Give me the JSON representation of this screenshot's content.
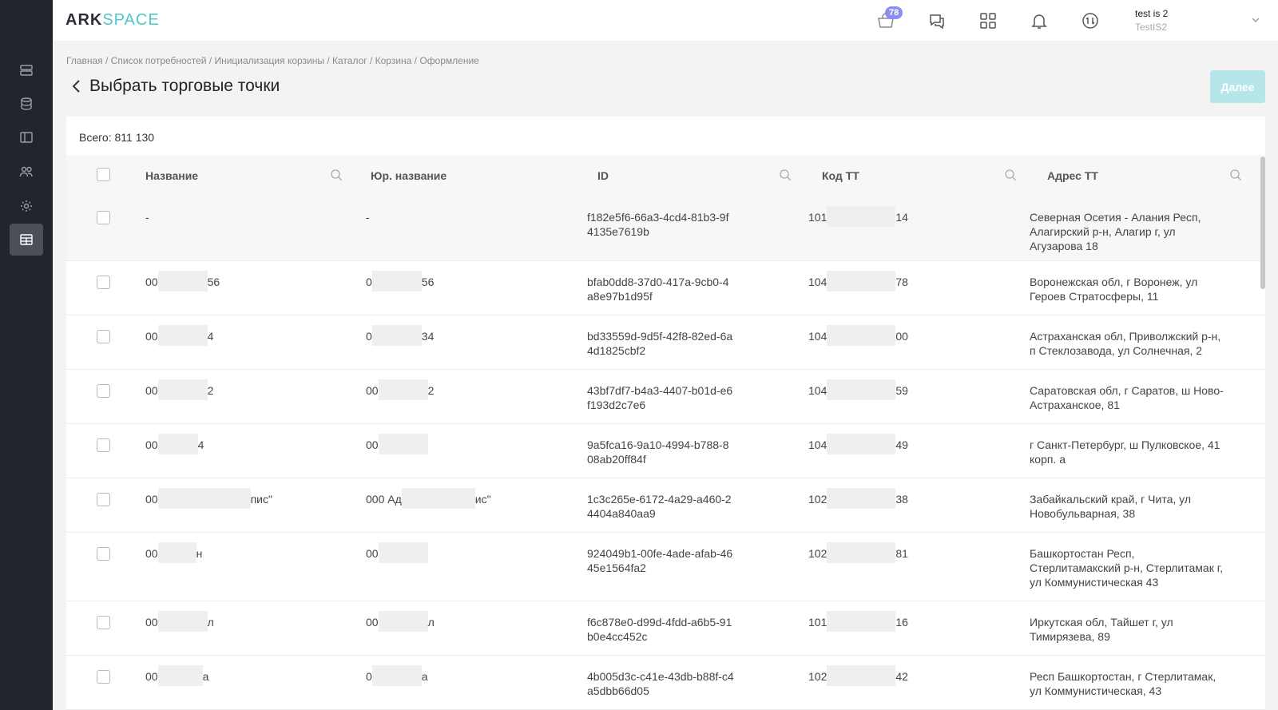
{
  "logo": {
    "ark": "ARK",
    "space": "SPACE"
  },
  "topbar": {
    "cart_badge": "78",
    "user_name": "test is 2",
    "user_org": "TestIS2"
  },
  "breadcrumb": "Главная / Список потребностей / Инициализация корзины / Каталог / Корзина / Оформление",
  "page_title": "Выбрать торговые точки",
  "next_label": "Далее",
  "total": "Всего: 811 130",
  "columns": [
    "Название",
    "Юр. название",
    "ID",
    "Код ТТ",
    "Адрес ТТ"
  ],
  "rows": [
    {
      "name": [
        "-",
        ""
      ],
      "legal": [
        "-",
        ""
      ],
      "id": "f182e5f6-66a3-4cd4-81b3-9f4135e7619b",
      "code": [
        "101",
        "14"
      ],
      "address": "Северная Осетия - Алания Респ, Алагирский р-н, Алагир г, ул Агузарова 18"
    },
    {
      "name": [
        "00",
        "56"
      ],
      "legal": [
        "0",
        "56"
      ],
      "id": "bfab0dd8-37d0-417a-9cb0-4a8e97b1d95f",
      "code": [
        "104",
        "78"
      ],
      "address": "Воронежская обл, г Воронеж, ул Героев Стратосферы, 11"
    },
    {
      "name": [
        "00",
        "4"
      ],
      "legal": [
        "0",
        "34"
      ],
      "id": "bd33559d-9d5f-42f8-82ed-6a4d1825cbf2",
      "code": [
        "104",
        "00"
      ],
      "address": "Астраханская обл, Приволжский р-н, п Стеклозавода, ул Солнечная, 2"
    },
    {
      "name": [
        "00",
        "2"
      ],
      "legal": [
        "00",
        "2"
      ],
      "id": "43bf7df7-b4a3-4407-b01d-e6f193d2c7e6",
      "code": [
        "104",
        "59"
      ],
      "address": "Саратовская обл, г Саратов, ш Ново-Астраханское, 81"
    },
    {
      "name": [
        "00",
        "4"
      ],
      "legal": [
        "00",
        ""
      ],
      "id": "9a5fca16-9a10-4994-b788-808ab20ff84f",
      "code": [
        "104",
        "49"
      ],
      "address": "г Санкт-Петербург, ш Пулковское, 41 корп. а"
    },
    {
      "name": [
        "00",
        "пис\""
      ],
      "legal": [
        "000 Ад",
        "ис\""
      ],
      "id": "1c3c265e-6172-4a29-a460-24404a840aa9",
      "code": [
        "102",
        "38"
      ],
      "address": "Забайкальский край, г Чита, ул Новобульварная, 38"
    },
    {
      "name": [
        "00",
        "н"
      ],
      "legal": [
        "00",
        ""
      ],
      "id": "924049b1-00fe-4ade-afab-4645e1564fa2",
      "code": [
        "102",
        "81"
      ],
      "address": "Башкортостан Респ, Стерлитамакский р-н, Стерлитамак г, ул Коммунистическая 43"
    },
    {
      "name": [
        "00",
        "л"
      ],
      "legal": [
        "00",
        "л"
      ],
      "id": "f6c878e0-d99d-4fdd-a6b5-91b0e4cc452c",
      "code": [
        "101",
        "16"
      ],
      "address": "Иркутская обл, Тайшет г, ул Тимирязева, 89"
    },
    {
      "name": [
        "00",
        "а"
      ],
      "legal": [
        "0",
        "а"
      ],
      "id": "4b005d3c-c41e-43db-b88f-c4a5dbb66d05",
      "code": [
        "102",
        "42"
      ],
      "address": "Респ Башкортостан, г Стерлитамак, ул Коммунистическая, 43"
    }
  ]
}
